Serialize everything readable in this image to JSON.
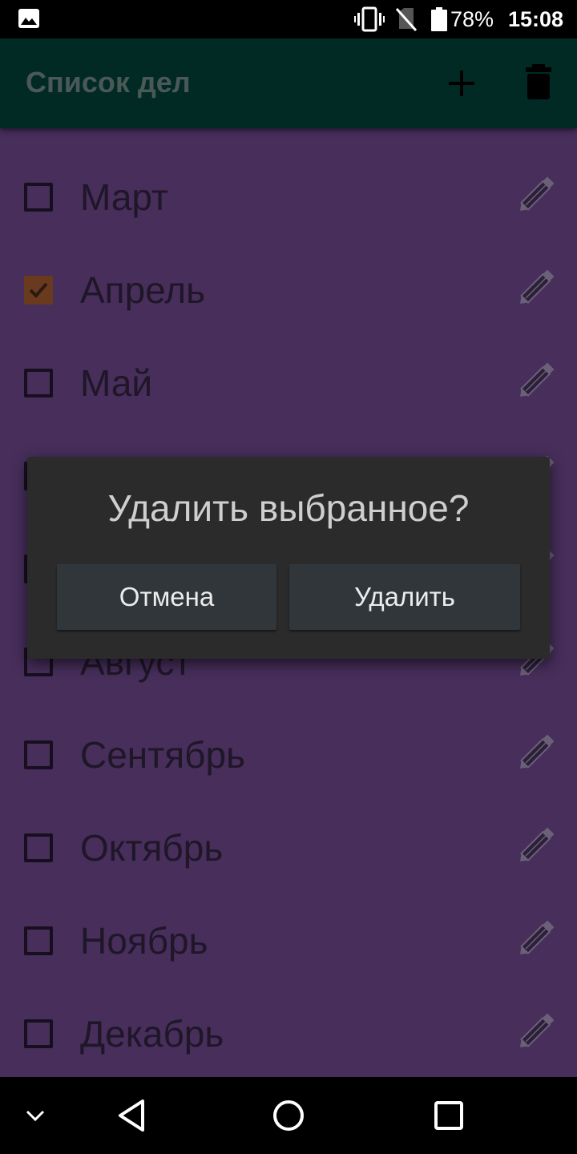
{
  "status_bar": {
    "battery_percent": "78%",
    "time": "15:08",
    "icons": [
      "gallery-icon",
      "vibrate-icon",
      "no-sim-icon",
      "battery-icon"
    ]
  },
  "app_bar": {
    "title": "Список дел",
    "actions": [
      "add-icon",
      "delete-icon"
    ]
  },
  "list": {
    "items": [
      {
        "label": "Март",
        "checked": false
      },
      {
        "label": "Апрель",
        "checked": true
      },
      {
        "label": "Май",
        "checked": false
      },
      {
        "label": "",
        "checked": false
      },
      {
        "label": "",
        "checked": false
      },
      {
        "label": "Август",
        "checked": false
      },
      {
        "label": "Сентябрь",
        "checked": false
      },
      {
        "label": "Октябрь",
        "checked": false
      },
      {
        "label": "Ноябрь",
        "checked": false
      },
      {
        "label": "Декабрь",
        "checked": false
      }
    ]
  },
  "dialog": {
    "title": "Удалить выбранное?",
    "cancel_label": "Отмена",
    "confirm_label": "Удалить"
  },
  "nav_bar": {
    "icons": [
      "collapse-icon",
      "back-icon",
      "home-icon",
      "recents-icon"
    ]
  },
  "colors": {
    "app_bar": "#012a24",
    "list_bg": "#472e5b",
    "dialog_bg": "#2b2b2b",
    "checked_box": "#6a3a1e"
  }
}
